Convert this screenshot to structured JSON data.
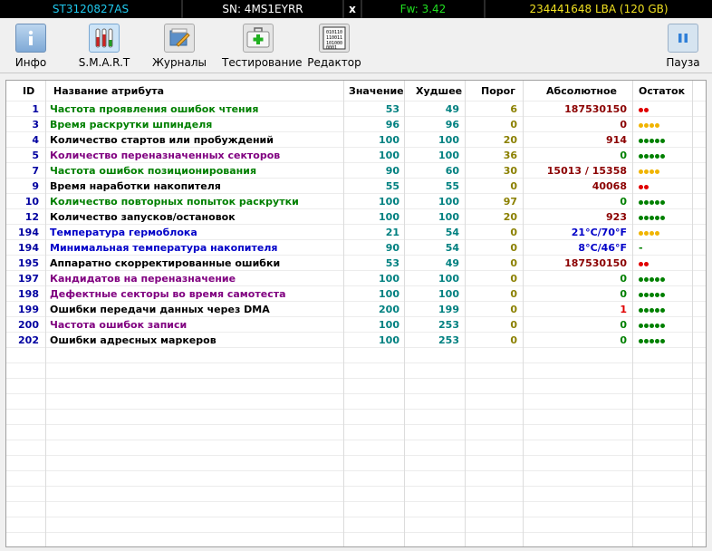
{
  "topbar": {
    "model": "ST3120827AS",
    "serial": "SN: 4MS1EYRR",
    "close": "x",
    "firmware": "Fw: 3.42",
    "capacity": "234441648 LBA (120 GB)"
  },
  "toolbar": {
    "info": "Инфо",
    "smart": "S.M.A.R.T",
    "journals": "Журналы",
    "testing": "Тестирование",
    "editor": "Редактор",
    "pause": "Пауза"
  },
  "table": {
    "headers": {
      "id": "ID",
      "name": "Название атрибута",
      "value": "Значение",
      "worst": "Худшее",
      "threshold": "Порог",
      "raw": "Абсолютное",
      "remain": "Остаток"
    },
    "rows": [
      {
        "id": "1",
        "name": "Частота проявления ошибок чтения",
        "value": "53",
        "worst": "49",
        "thr": "6",
        "raw": "187530150",
        "rem": "dots",
        "dots": 2,
        "dot_color": "#e00000",
        "name_color": "#008000",
        "raw_color": "#8b0000"
      },
      {
        "id": "3",
        "name": "Время раскрутки шпинделя",
        "value": "96",
        "worst": "96",
        "thr": "0",
        "raw": "0",
        "rem": "dots",
        "dots": 4,
        "dot_color": "#f0b400",
        "name_color": "#008000",
        "raw_color": "#8b0000"
      },
      {
        "id": "4",
        "name": "Количество стартов или пробуждений",
        "value": "100",
        "worst": "100",
        "thr": "20",
        "raw": "914",
        "rem": "dots",
        "dots": 5,
        "dot_color": "#008000",
        "name_color": "#000000",
        "raw_color": "#8b0000"
      },
      {
        "id": "5",
        "name": "Количество переназначенных секторов",
        "value": "100",
        "worst": "100",
        "thr": "36",
        "raw": "0",
        "rem": "dots",
        "dots": 5,
        "dot_color": "#008000",
        "name_color": "#800080",
        "raw_color": "#008000"
      },
      {
        "id": "7",
        "name": "Частота ошибок позиционирования",
        "value": "90",
        "worst": "60",
        "thr": "30",
        "raw": "15013 / 15358",
        "rem": "dots",
        "dots": 4,
        "dot_color": "#f0b400",
        "name_color": "#008000",
        "raw_color": "#8b0000"
      },
      {
        "id": "9",
        "name": "Время наработки накопителя",
        "value": "55",
        "worst": "55",
        "thr": "0",
        "raw": "40068",
        "rem": "dots",
        "dots": 2,
        "dot_color": "#e00000",
        "name_color": "#000000",
        "raw_color": "#8b0000"
      },
      {
        "id": "10",
        "name": "Количество повторных попыток раскрутки",
        "value": "100",
        "worst": "100",
        "thr": "97",
        "raw": "0",
        "rem": "dots",
        "dots": 5,
        "dot_color": "#008000",
        "name_color": "#008000",
        "raw_color": "#008000"
      },
      {
        "id": "12",
        "name": "Количество запусков/остановок",
        "value": "100",
        "worst": "100",
        "thr": "20",
        "raw": "923",
        "rem": "dots",
        "dots": 5,
        "dot_color": "#008000",
        "name_color": "#000000",
        "raw_color": "#8b0000"
      },
      {
        "id": "194",
        "name": "Температура гермоблока",
        "value": "21",
        "worst": "54",
        "thr": "0",
        "raw": "21°C/70°F",
        "rem": "dots",
        "dots": 4,
        "dot_color": "#f0b400",
        "name_color": "#0000c8",
        "raw_color": "#0000c8"
      },
      {
        "id": "194",
        "name": "Минимальная температура накопителя",
        "value": "90",
        "worst": "54",
        "thr": "0",
        "raw": "8°C/46°F",
        "rem": "-",
        "dots": 0,
        "dot_color": "#008000",
        "name_color": "#0000c8",
        "raw_color": "#0000c8"
      },
      {
        "id": "195",
        "name": "Аппаратно скорректированные ошибки",
        "value": "53",
        "worst": "49",
        "thr": "0",
        "raw": "187530150",
        "rem": "dots",
        "dots": 2,
        "dot_color": "#e00000",
        "name_color": "#000000",
        "raw_color": "#8b0000"
      },
      {
        "id": "197",
        "name": "Кандидатов на переназначение",
        "value": "100",
        "worst": "100",
        "thr": "0",
        "raw": "0",
        "rem": "dots",
        "dots": 5,
        "dot_color": "#008000",
        "name_color": "#800080",
        "raw_color": "#008000"
      },
      {
        "id": "198",
        "name": "Дефектные секторы во время самотеста",
        "value": "100",
        "worst": "100",
        "thr": "0",
        "raw": "0",
        "rem": "dots",
        "dots": 5,
        "dot_color": "#008000",
        "name_color": "#800080",
        "raw_color": "#008000"
      },
      {
        "id": "199",
        "name": "Ошибки передачи данных через DMA",
        "value": "200",
        "worst": "199",
        "thr": "0",
        "raw": "1",
        "rem": "dots",
        "dots": 5,
        "dot_color": "#008000",
        "name_color": "#000000",
        "raw_color": "#e00000"
      },
      {
        "id": "200",
        "name": "Частота ошибок записи",
        "value": "100",
        "worst": "253",
        "thr": "0",
        "raw": "0",
        "rem": "dots",
        "dots": 5,
        "dot_color": "#008000",
        "name_color": "#800080",
        "raw_color": "#008000"
      },
      {
        "id": "202",
        "name": "Ошибки адресных маркеров",
        "value": "100",
        "worst": "253",
        "thr": "0",
        "raw": "0",
        "rem": "dots",
        "dots": 5,
        "dot_color": "#008000",
        "name_color": "#000000",
        "raw_color": "#008000"
      }
    ]
  }
}
